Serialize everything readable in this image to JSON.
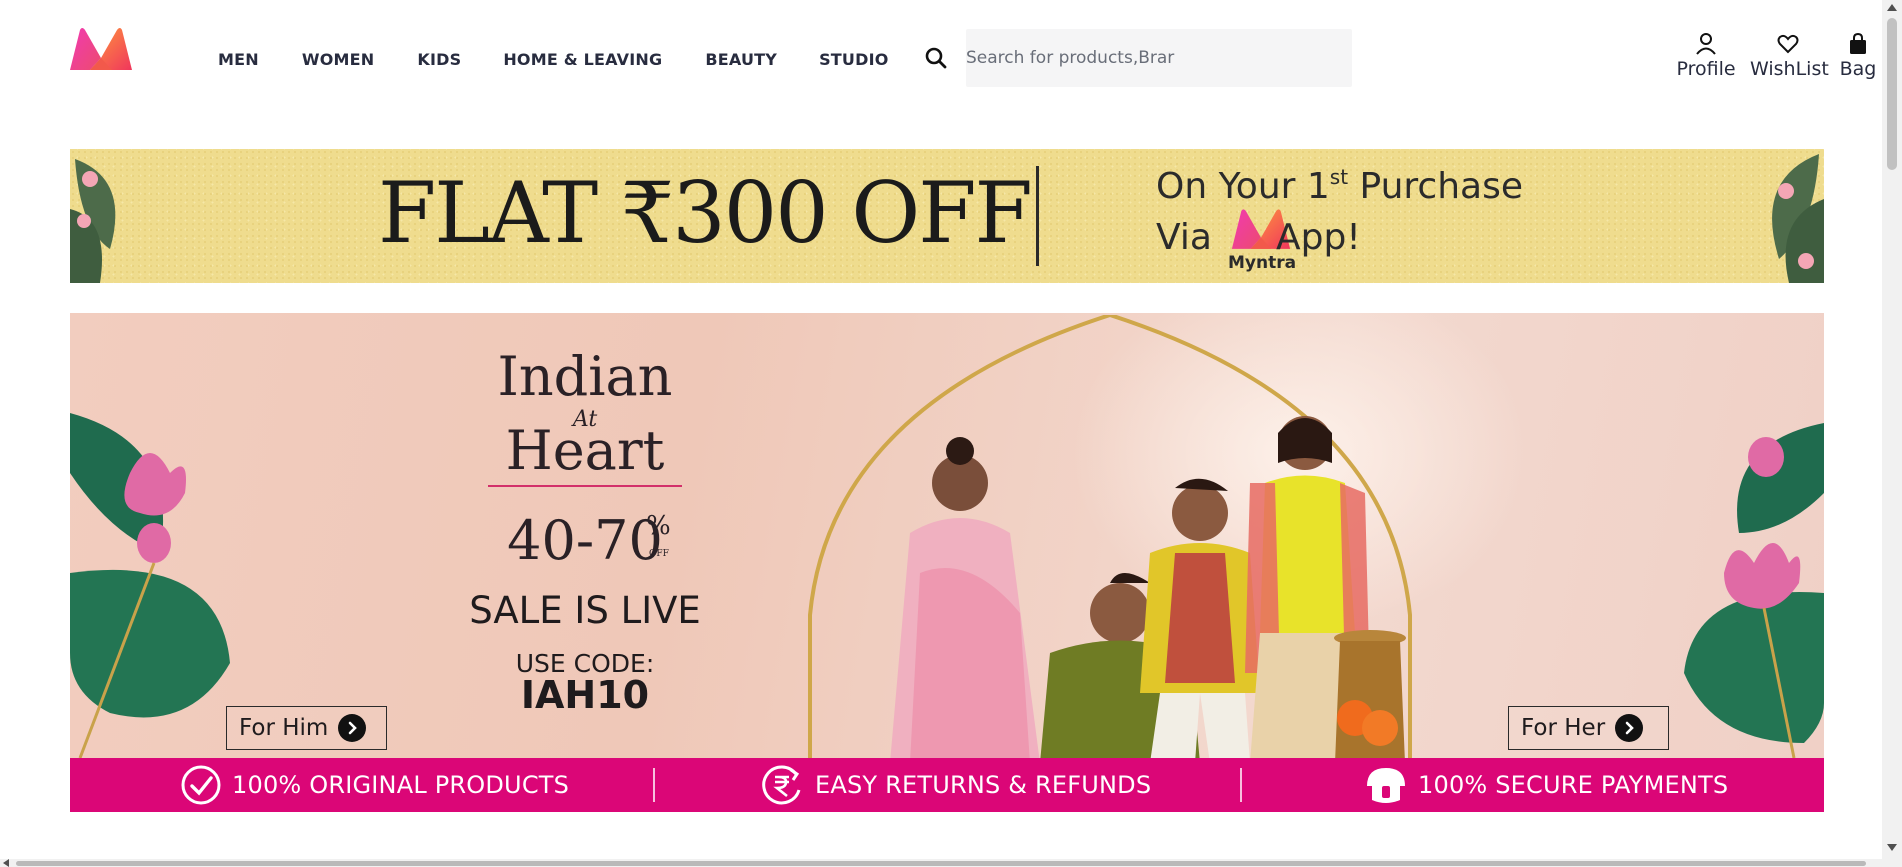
{
  "header": {
    "nav": [
      {
        "label": "MEN"
      },
      {
        "label": "WOMEN"
      },
      {
        "label": "KIDS"
      },
      {
        "label": "HOME & LEAVING"
      },
      {
        "label": "BEAUTY"
      },
      {
        "label": "STUDIO"
      }
    ],
    "search": {
      "placeholder": "Search for products,Brar",
      "value": ""
    },
    "actions": {
      "profile": "Profile",
      "wishlist": "WishList",
      "bag": "Bag"
    }
  },
  "promo": {
    "headline": "FLAT ₹300 OFF",
    "line1": "On Your 1",
    "line1_sup": "st",
    "line1_end": " Purchase",
    "via": "Via",
    "app": "App!",
    "brand": "Myntra"
  },
  "hero": {
    "title1": "Indian",
    "at": "At",
    "title2": "Heart",
    "discount": "40-70",
    "pct": "%",
    "off": "OFF",
    "sale": "SALE IS LIVE",
    "code_label": "USE CODE:",
    "code": "IAH10",
    "for_him": "For Him",
    "for_her": "For Her"
  },
  "trust": [
    {
      "label": "100% ORIGINAL PRODUCTS",
      "icon": "check-circle-icon"
    },
    {
      "label": "EASY RETURNS & REFUNDS",
      "icon": "rupee-return-icon"
    },
    {
      "label": "100% SECURE PAYMENTS",
      "icon": "umbrella-shield-icon"
    }
  ],
  "colors": {
    "brand_pink": "#db0677",
    "text": "#282c3f",
    "promo_bg": "#efdc8e",
    "search_bg": "#f5f5f6"
  }
}
